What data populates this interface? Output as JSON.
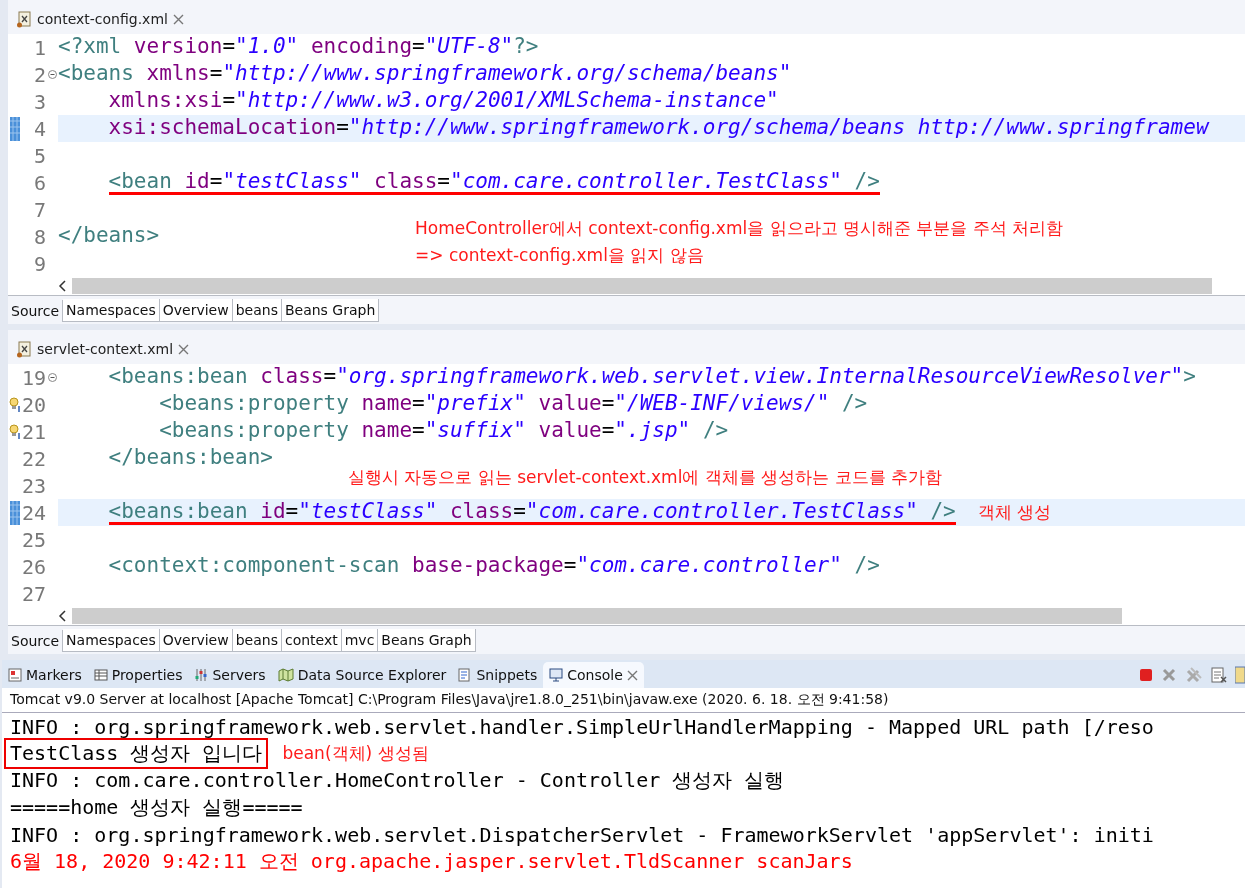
{
  "editors": [
    {
      "file": "context-config.xml",
      "lines": [
        {
          "number": "1",
          "fold": false,
          "current": false,
          "bookmark": false,
          "hint": false,
          "underlined": false,
          "tokens": [
            {
              "kind": "tag",
              "text": "<?xml "
            },
            {
              "kind": "attr",
              "text": "version"
            },
            {
              "kind": "eq",
              "text": "="
            },
            {
              "kind": "str",
              "text": "\"1.0\" "
            },
            {
              "kind": "attr",
              "text": "encoding"
            },
            {
              "kind": "eq",
              "text": "="
            },
            {
              "kind": "str",
              "text": "\"UTF-8\""
            },
            {
              "kind": "tag",
              "text": "?>"
            }
          ]
        },
        {
          "number": "2",
          "fold": true,
          "current": false,
          "bookmark": false,
          "hint": false,
          "underlined": false,
          "tokens": [
            {
              "kind": "tag",
              "text": "<beans "
            },
            {
              "kind": "attr",
              "text": "xmlns"
            },
            {
              "kind": "eq",
              "text": "="
            },
            {
              "kind": "str",
              "text": "\"http://www.springframework.org/schema/beans\""
            }
          ]
        },
        {
          "number": "3",
          "fold": false,
          "current": false,
          "bookmark": false,
          "hint": false,
          "underlined": false,
          "tokens": [
            {
              "kind": "attr",
              "text": "    xmlns:xsi"
            },
            {
              "kind": "eq",
              "text": "="
            },
            {
              "kind": "str",
              "text": "\"http://www.w3.org/2001/XMLSchema-instance\""
            }
          ]
        },
        {
          "number": "4",
          "fold": false,
          "current": true,
          "bookmark": true,
          "hint": false,
          "underlined": false,
          "tokens": [
            {
              "kind": "attr",
              "text": "    xsi:schemaLocation"
            },
            {
              "kind": "eq",
              "text": "="
            },
            {
              "kind": "str",
              "text": "\"http://www.springframework.org/schema/beans http://www.springframew"
            }
          ]
        },
        {
          "number": "5",
          "fold": false,
          "current": false,
          "bookmark": false,
          "hint": false,
          "underlined": false
        },
        {
          "number": "6",
          "fold": false,
          "current": false,
          "bookmark": false,
          "hint": false,
          "underlined": true,
          "tokens": [
            {
              "kind": "tag",
              "text": "    <bean "
            },
            {
              "kind": "attr",
              "text": "id"
            },
            {
              "kind": "eq",
              "text": "="
            },
            {
              "kind": "str",
              "text": "\"testClass\" "
            },
            {
              "kind": "attr",
              "text": "class"
            },
            {
              "kind": "eq",
              "text": "="
            },
            {
              "kind": "str",
              "text": "\"com.care.controller.TestClass\" "
            },
            {
              "kind": "tag",
              "text": "/>"
            }
          ]
        },
        {
          "number": "7",
          "fold": false,
          "current": false,
          "bookmark": false,
          "hint": false,
          "underlined": false
        },
        {
          "number": "8",
          "fold": false,
          "current": false,
          "bookmark": false,
          "hint": false,
          "underlined": false,
          "tokens": [
            {
              "kind": "tag",
              "text": "</beans>"
            }
          ],
          "note": {
            "kind": "aside",
            "text": "HomeController에서 context-config.xml을 읽으라고 명시해준 부분을 주석 처리함"
          }
        },
        {
          "number": "9",
          "fold": false,
          "current": false,
          "bookmark": false,
          "hint": false,
          "underlined": false,
          "note": {
            "kind": "aside",
            "text": "=> context-config.xml을 읽지 않음"
          }
        }
      ],
      "bottom_tabs": [
        {
          "label": "Source",
          "selected": true
        },
        {
          "label": "Namespaces",
          "selected": false
        },
        {
          "label": "Overview",
          "selected": false
        },
        {
          "label": "beans",
          "selected": false
        },
        {
          "label": "Beans Graph",
          "selected": false
        }
      ]
    },
    {
      "file": "servlet-context.xml",
      "lines": [
        {
          "number": "19",
          "fold": true,
          "current": false,
          "bookmark": false,
          "hint": false,
          "underlined": false,
          "tokens": [
            {
              "kind": "tag",
              "text": "    <beans:bean "
            },
            {
              "kind": "attr",
              "text": "class"
            },
            {
              "kind": "eq",
              "text": "="
            },
            {
              "kind": "str",
              "text": "\"org.springframework.web.servlet.view.InternalResourceViewResolver\""
            },
            {
              "kind": "tag",
              "text": ">"
            }
          ]
        },
        {
          "number": "20",
          "fold": false,
          "current": false,
          "bookmark": false,
          "hint": true,
          "underlined": false,
          "tokens": [
            {
              "kind": "tag",
              "text": "        <beans:property "
            },
            {
              "kind": "attr",
              "text": "name"
            },
            {
              "kind": "eq",
              "text": "="
            },
            {
              "kind": "str",
              "text": "\"prefix\" "
            },
            {
              "kind": "attr",
              "text": "value"
            },
            {
              "kind": "eq",
              "text": "="
            },
            {
              "kind": "str",
              "text": "\"/WEB-INF/views/\" "
            },
            {
              "kind": "tag",
              "text": "/>"
            }
          ]
        },
        {
          "number": "21",
          "fold": false,
          "current": false,
          "bookmark": false,
          "hint": true,
          "underlined": false,
          "tokens": [
            {
              "kind": "tag",
              "text": "        <beans:property "
            },
            {
              "kind": "attr",
              "text": "name"
            },
            {
              "kind": "eq",
              "text": "="
            },
            {
              "kind": "str",
              "text": "\"suffix\" "
            },
            {
              "kind": "attr",
              "text": "value"
            },
            {
              "kind": "eq",
              "text": "="
            },
            {
              "kind": "str",
              "text": "\".jsp\" "
            },
            {
              "kind": "tag",
              "text": "/>"
            }
          ]
        },
        {
          "number": "22",
          "fold": false,
          "current": false,
          "bookmark": false,
          "hint": false,
          "underlined": false,
          "tokens": [
            {
              "kind": "tag",
              "text": "    </beans:bean>"
            }
          ]
        },
        {
          "number": "23",
          "fold": false,
          "current": false,
          "bookmark": false,
          "hint": false,
          "underlined": false,
          "note": {
            "kind": "aside",
            "text": "실행시 자동으로 읽는 servlet-context.xml에 객체를 생성하는 코드를 추가함"
          }
        },
        {
          "number": "24",
          "fold": false,
          "current": true,
          "bookmark": true,
          "hint": false,
          "underlined": true,
          "tokens": [
            {
              "kind": "tag",
              "text": "    <beans:bean "
            },
            {
              "kind": "attr",
              "text": "id"
            },
            {
              "kind": "eq",
              "text": "="
            },
            {
              "kind": "str",
              "text": "\"testClass\" "
            },
            {
              "kind": "attr",
              "text": "class"
            },
            {
              "kind": "eq",
              "text": "="
            },
            {
              "kind": "str",
              "text": "\"com.care.controller.TestClass\" "
            },
            {
              "kind": "tag",
              "text": "/>"
            }
          ],
          "note": {
            "kind": "inline",
            "text": "객체 생성"
          }
        },
        {
          "number": "25",
          "fold": false,
          "current": false,
          "bookmark": false,
          "hint": false,
          "underlined": false
        },
        {
          "number": "26",
          "fold": false,
          "current": false,
          "bookmark": false,
          "hint": false,
          "underlined": false,
          "tokens": [
            {
              "kind": "tag",
              "text": "    <context:component-scan "
            },
            {
              "kind": "attr",
              "text": "base-package"
            },
            {
              "kind": "eq",
              "text": "="
            },
            {
              "kind": "str",
              "text": "\"com.care.controller\" "
            },
            {
              "kind": "tag",
              "text": "/>"
            }
          ]
        },
        {
          "number": "27",
          "fold": false,
          "current": false,
          "bookmark": false,
          "hint": false,
          "underlined": false
        }
      ],
      "bottom_tabs": [
        {
          "label": "Source",
          "selected": true
        },
        {
          "label": "Namespaces",
          "selected": false
        },
        {
          "label": "Overview",
          "selected": false
        },
        {
          "label": "beans",
          "selected": false
        },
        {
          "label": "context",
          "selected": false
        },
        {
          "label": "mvc",
          "selected": false
        },
        {
          "label": "Beans Graph",
          "selected": false
        }
      ]
    }
  ],
  "console": {
    "tabs": [
      {
        "label": "Markers",
        "selected": false
      },
      {
        "label": "Properties",
        "selected": false
      },
      {
        "label": "Servers",
        "selected": false
      },
      {
        "label": "Data Source Explorer",
        "selected": false
      },
      {
        "label": "Snippets",
        "selected": false
      },
      {
        "label": "Console",
        "selected": true
      }
    ],
    "process": "Tomcat v9.0 Server at localhost [Apache Tomcat] C:\\Program Files\\Java\\jre1.8.0_251\\bin\\javaw.exe  (2020. 6. 18. 오전 9:41:58)",
    "lines": [
      {
        "kind": "out",
        "boxed": false,
        "text": "INFO : org.springframework.web.servlet.handler.SimpleUrlHandlerMapping - Mapped URL path [/reso"
      },
      {
        "kind": "out",
        "boxed": true,
        "text": "TestClass 생성자 입니다",
        "note": "bean(객체) 생성됨"
      },
      {
        "kind": "out",
        "boxed": false,
        "text": "INFO : com.care.controller.HomeController - Controller 생성자 실행"
      },
      {
        "kind": "out",
        "boxed": false,
        "text": "=====home 생성자 실행====="
      },
      {
        "kind": "out",
        "boxed": false,
        "text": "INFO : org.springframework.web.servlet.DispatcherServlet - FrameworkServlet 'appServlet': initi"
      },
      {
        "kind": "err",
        "boxed": false,
        "text": "6월 18, 2020 9:42:11 오전 org.apache.jasper.servlet.TldScanner scanJars"
      }
    ]
  }
}
